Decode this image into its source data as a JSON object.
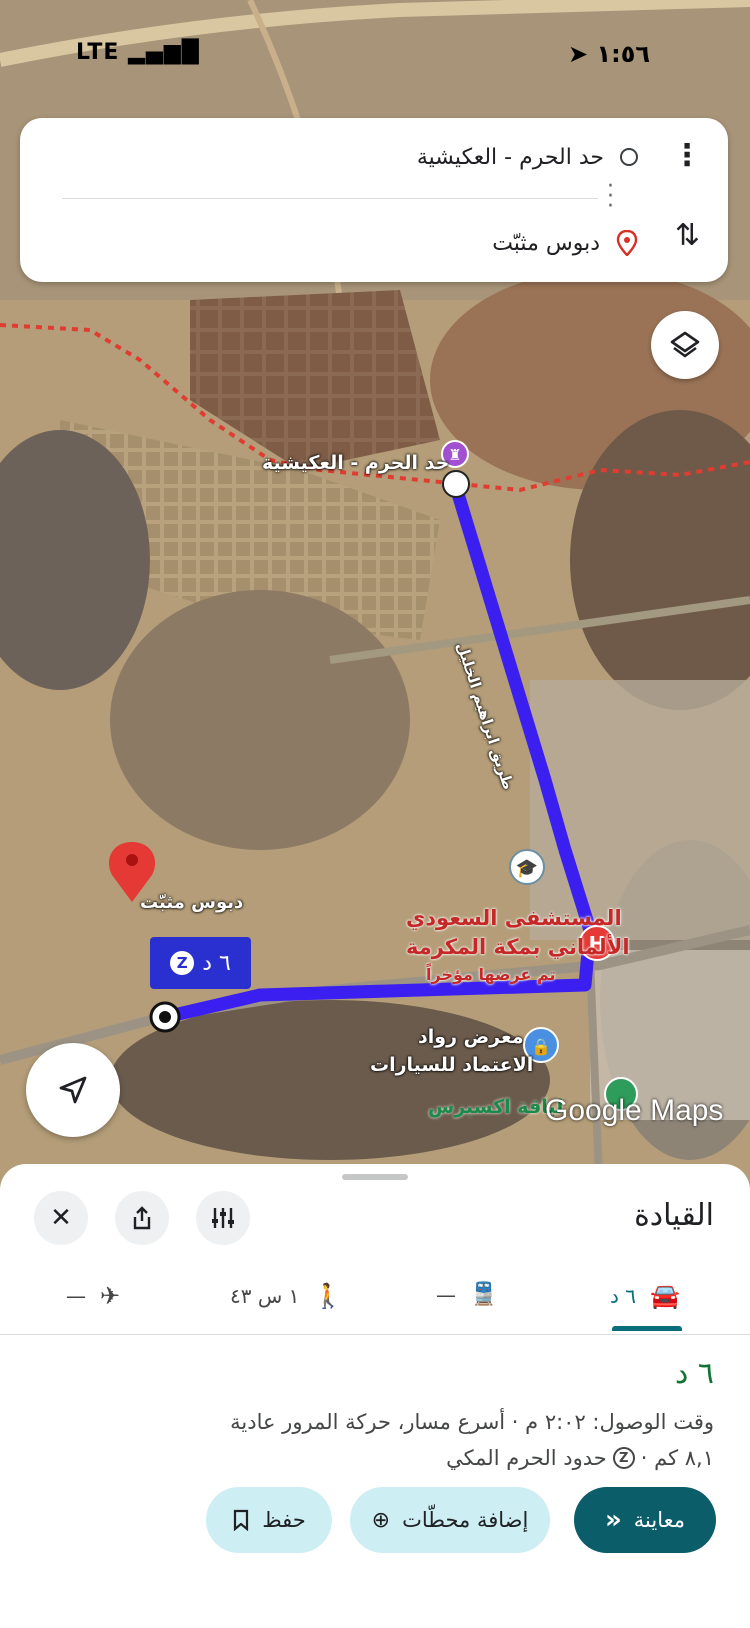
{
  "status_bar": {
    "time": "١:٥٦",
    "network": "LTE"
  },
  "search": {
    "origin": "حد الحرم - العكيشية",
    "destination": "دبوس مثبّت"
  },
  "map": {
    "label_origin": "حد الحرم - العكيشية",
    "label_destination": "دبوس مثبّت",
    "label_road": "طريق ابراهيم الخليل",
    "label_hospital_1": "المستشفى السعودي",
    "label_hospital_2": "الألماني بمكة المكرمة",
    "label_hospital_3": "تم عرضها مؤخراً",
    "label_showroom_1": "معرض رواد",
    "label_showroom_2": "الاعتماد للسيارات",
    "label_express": "لياقة اكسبرس",
    "route_badge": "٦ د",
    "attribution": "Google Maps",
    "route_color": "#3a1ff0",
    "boundary_color": "#e03c31"
  },
  "sheet": {
    "title": "القيادة",
    "modes": {
      "drive": "٦ د",
      "transit": "—",
      "walk": "١ س ٤٣",
      "flight": "—"
    },
    "duration": "٦ د",
    "eta_line": "وقت الوصول: ٢:٠٢ م · أسرع مسار، حركة المرور عادية",
    "distance": "٨,١ كم ·",
    "zone_note": "حدود الحرم المكي",
    "buttons": {
      "preview": "معاينة",
      "add_stops": "إضافة محطّات",
      "save": "حفظ"
    }
  },
  "colors": {
    "accent": "#0b5d69",
    "chip_bg": "#cdeef3",
    "duration_green": "#137333"
  }
}
